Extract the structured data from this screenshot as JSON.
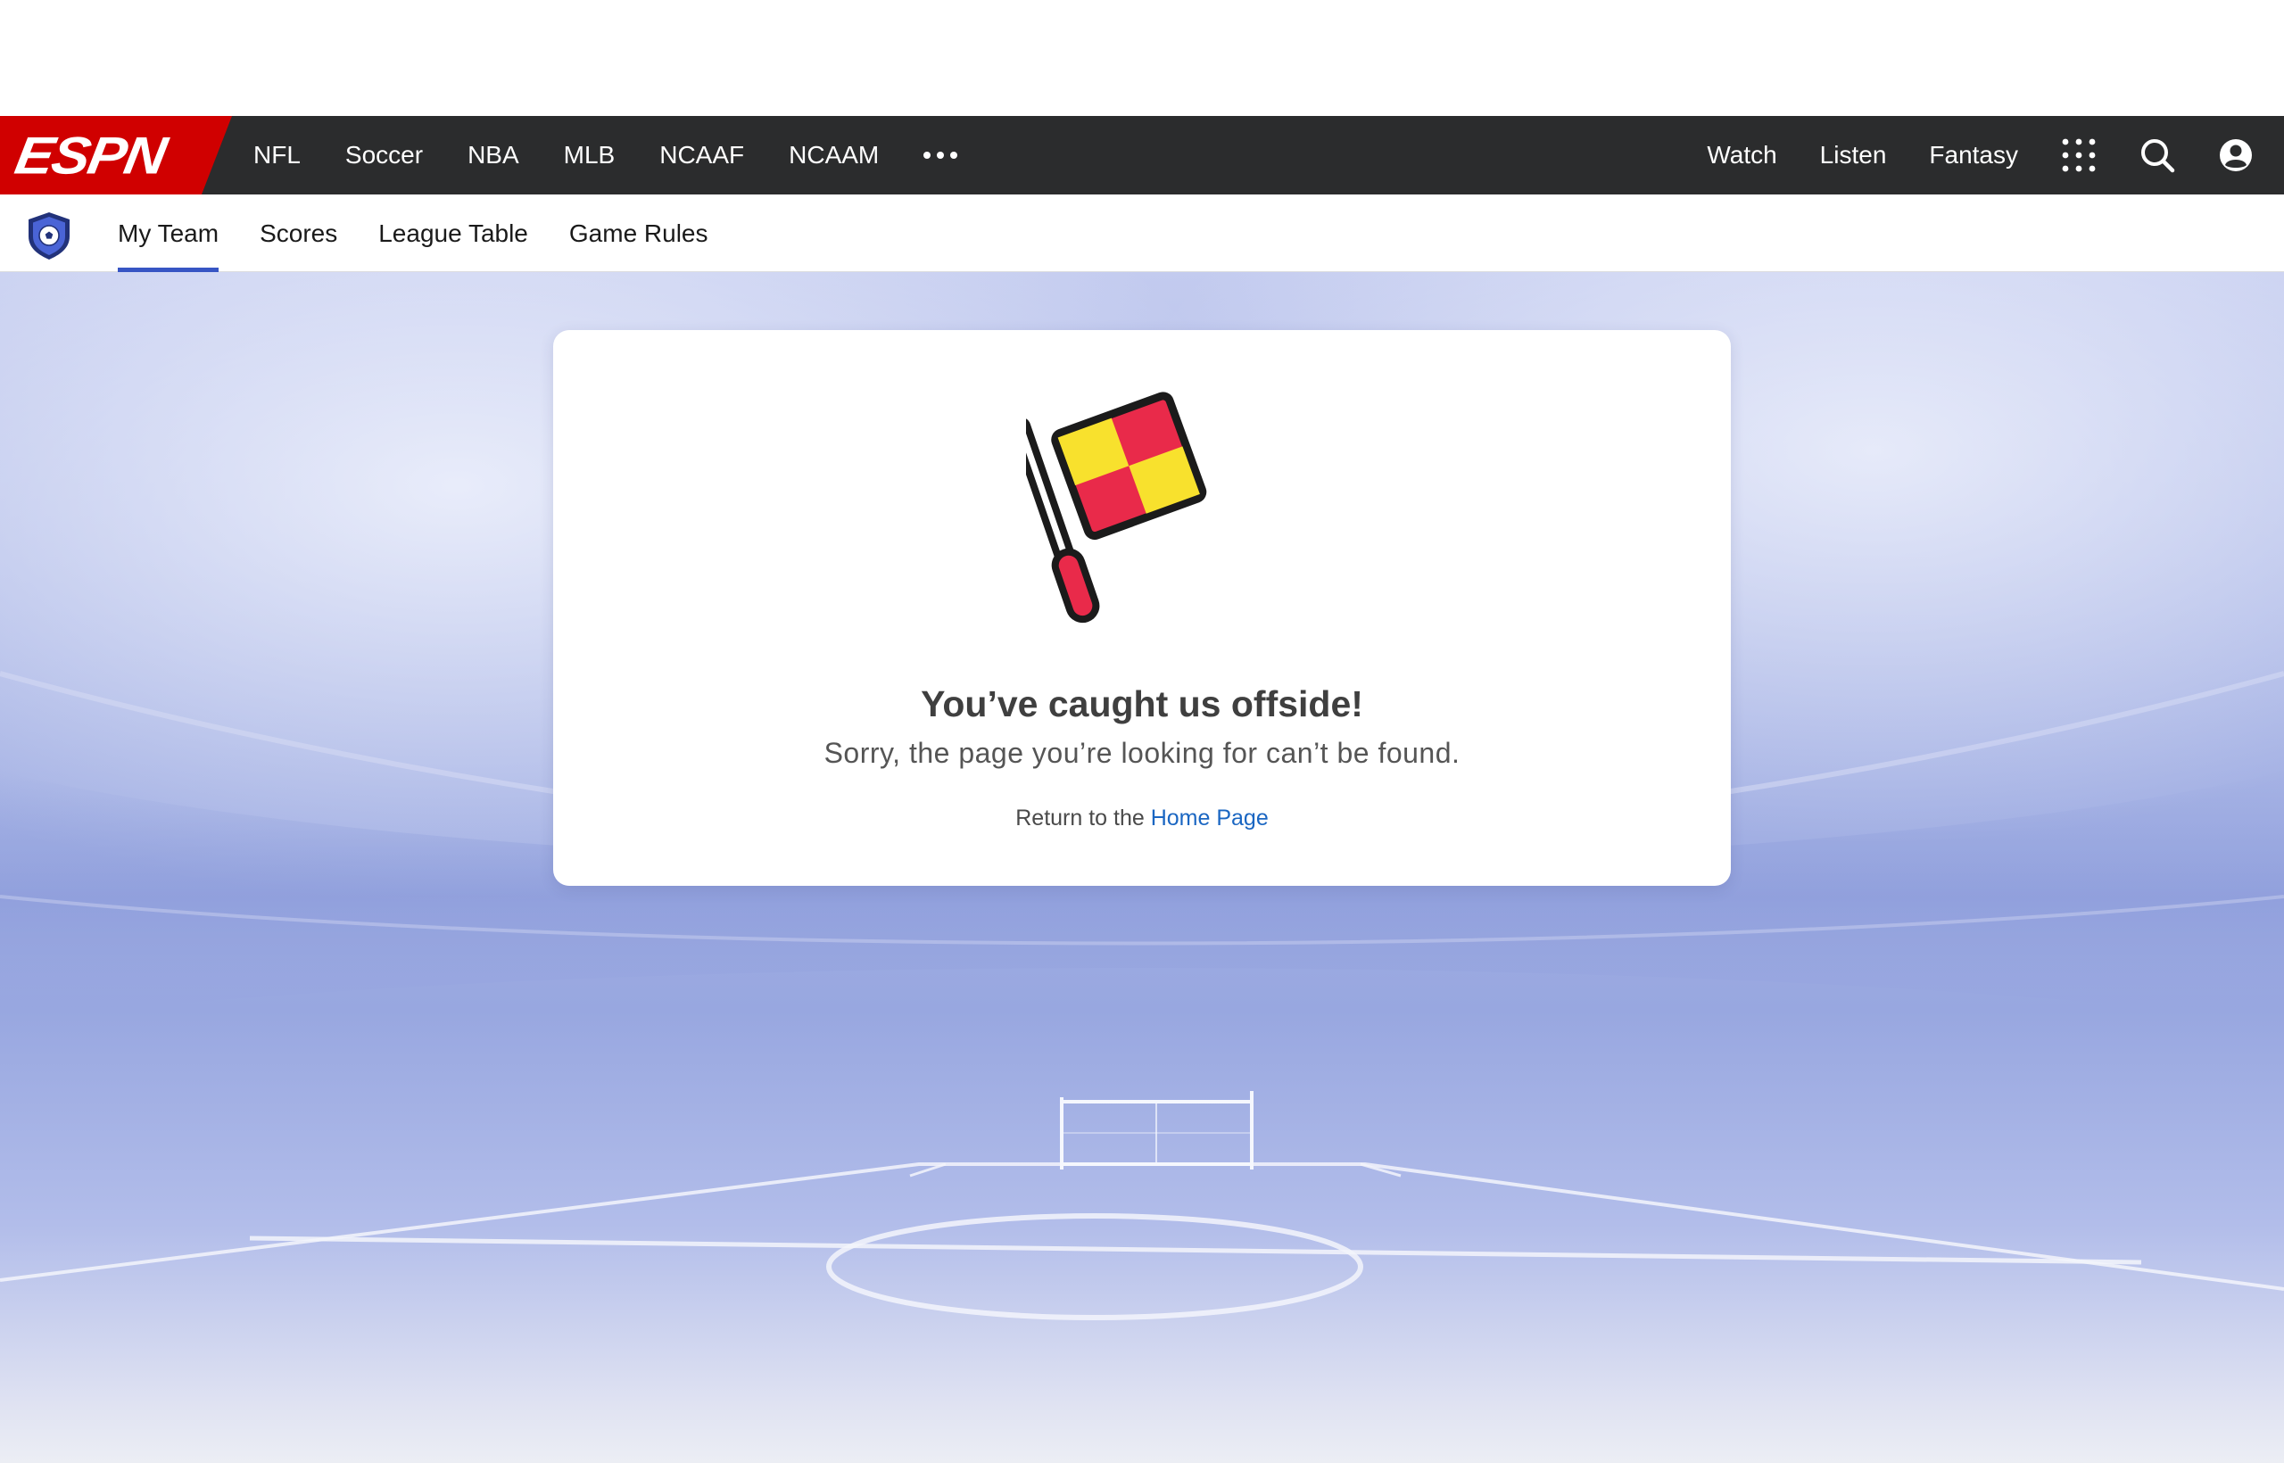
{
  "brand": {
    "logo_text": "ESPN",
    "red": "#d00000",
    "nav_bg": "#2b2c2d",
    "accent": "#3755c4",
    "link": "#1a66c2"
  },
  "top_nav": {
    "left_items": [
      "NFL",
      "Soccer",
      "NBA",
      "MLB",
      "NCAAF",
      "NCAAM"
    ],
    "more_icon": "ellipsis-icon",
    "right_items": [
      "Watch",
      "Listen",
      "Fantasy"
    ],
    "icons": [
      "apps-grid-icon",
      "search-icon",
      "user-account-icon"
    ]
  },
  "sub_nav": {
    "logo_icon": "soccer-shield-icon",
    "items": [
      "My Team",
      "Scores",
      "League Table",
      "Game Rules"
    ],
    "active": "My Team"
  },
  "error_card": {
    "icon": "offside-flag-icon",
    "title": "You’ve caught us offside!",
    "subtitle": "Sorry, the page you’re looking for can’t be found.",
    "return_prefix": "Return to the",
    "return_link": "Home Page"
  }
}
